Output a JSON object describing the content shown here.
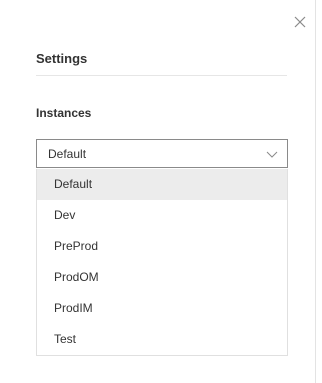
{
  "settings": {
    "title": "Settings",
    "instances_label": "Instances",
    "instance_select": {
      "selected": "Default",
      "options": [
        "Default",
        "Dev",
        "PreProd",
        "ProdOM",
        "ProdIM",
        "Test"
      ]
    }
  },
  "icons": {
    "close": "close-icon",
    "chevron": "chevron-down-icon"
  },
  "colors": {
    "text": "#333333",
    "highlight": "#ececec",
    "border": "#8a8a8a"
  }
}
